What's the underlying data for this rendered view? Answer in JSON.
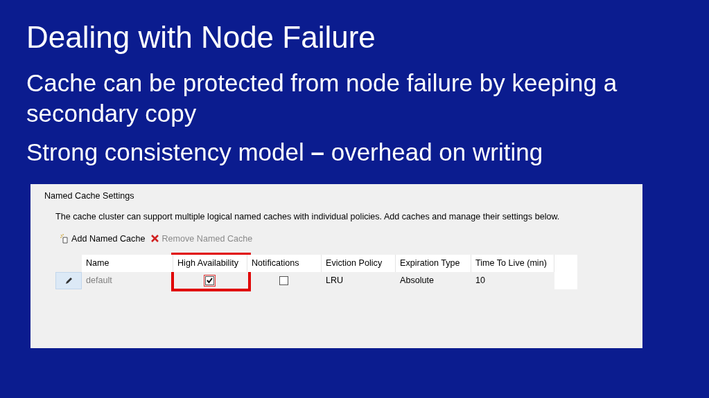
{
  "slide": {
    "title": "Dealing with Node Failure",
    "bullets": [
      "Cache can be protected from node failure by keeping a secondary copy",
      "Strong consistency model **–** overhead on writing"
    ]
  },
  "panel": {
    "title": "Named Cache Settings",
    "description": "The cache cluster can support multiple logical named caches with individual policies. Add caches and manage their settings below.",
    "toolbar": [
      {
        "kind": "add",
        "label": "Add Named Cache",
        "disabled": false
      },
      {
        "kind": "remove",
        "label": "Remove Named Cache",
        "disabled": true
      }
    ],
    "table": {
      "columns": [
        {
          "label": "Name",
          "highlighted": false
        },
        {
          "label": "High Availability",
          "highlighted": true
        },
        {
          "label": "Notifications",
          "highlighted": false
        },
        {
          "label": "Eviction Policy",
          "highlighted": false
        },
        {
          "label": "Expiration Type",
          "highlighted": false
        },
        {
          "label": "Time To Live (min)",
          "highlighted": false
        }
      ],
      "rows": [
        {
          "cells": [
            {
              "kind": "text",
              "text": "default",
              "disabled": true
            },
            {
              "kind": "checkbox",
              "checked": true
            },
            {
              "kind": "checkbox",
              "checked": false
            },
            {
              "kind": "text",
              "text": "LRU",
              "disabled": false
            },
            {
              "kind": "text",
              "text": "Absolute",
              "disabled": false
            },
            {
              "kind": "text",
              "text": "10",
              "disabled": false
            }
          ]
        }
      ]
    }
  }
}
